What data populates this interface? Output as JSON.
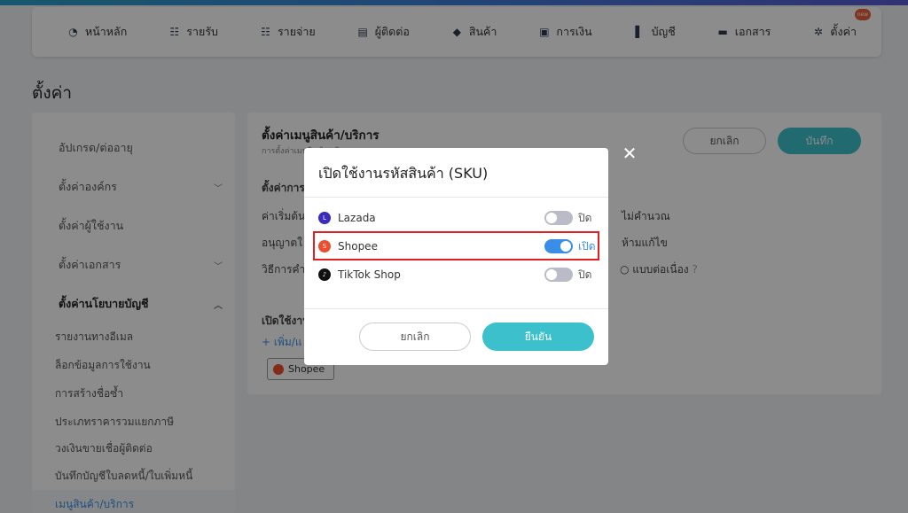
{
  "nav": {
    "items": [
      {
        "label": "หน้าหลัก",
        "icon": "dashboard-icon"
      },
      {
        "label": "รายรับ",
        "icon": "income-icon"
      },
      {
        "label": "รายจ่าย",
        "icon": "expense-icon"
      },
      {
        "label": "ผู้ติดต่อ",
        "icon": "contacts-icon"
      },
      {
        "label": "สินค้า",
        "icon": "box-icon"
      },
      {
        "label": "การเงิน",
        "icon": "money-icon"
      },
      {
        "label": "บัญชี",
        "icon": "book-icon"
      },
      {
        "label": "เอกสาร",
        "icon": "folder-icon"
      },
      {
        "label": "ตั้งค่า",
        "icon": "gear-icon",
        "badge": "new"
      }
    ]
  },
  "page": {
    "title": "ตั้งค่า"
  },
  "sidebar": {
    "items": [
      {
        "label": "อัปเกรด/ต่ออายุ"
      },
      {
        "label": "ตั้งค่าองค์กร"
      },
      {
        "label": "ตั้งค่าผู้ใช้งาน"
      },
      {
        "label": "ตั้งค่าเอกสาร"
      },
      {
        "label": "ตั้งค่านโยบายบัญชี"
      }
    ],
    "subitems": [
      "รายงานทางอีเมล",
      "ล็อกข้อมูลการใช้งาน",
      "การสร้างชื่อซ้ำ",
      "ประเภทราคารวมแยกภาษี",
      "วงเงินขายเชื่อผู้ติดต่อ",
      "บันทึกบัญชีใบลดหนี้/ใบเพิ่มหนี้",
      "เมนูสินค้า/บริการ"
    ]
  },
  "main": {
    "title": "ตั้งค่าเมนูสินค้า/บริการ",
    "desc": "การตั้งค่าเมนูสินค้า/บริการ",
    "cancel": "ยกเลิก",
    "save": "บันทึก",
    "section1": "ตั้งค่าการ",
    "row1": "ค่าเริ่มต้นใ",
    "row1_right": "ไม่คำนวณ",
    "row2": "อนุญาตใ",
    "row2_right": "ห้ามแก้ไข",
    "row3": "วิธีการคำ",
    "row3_right": "แบบต่อเนื่อง",
    "section2": "เปิดใช้งาน",
    "add": "+ เพิ่ม/แ",
    "tag": "Shopee"
  },
  "modal": {
    "title": "เปิดใช้งานรหัสสินค้า (SKU)",
    "platforms": [
      {
        "name": "Lazada",
        "state": "ปิด",
        "on": false,
        "color": "#3b2bbd"
      },
      {
        "name": "Shopee",
        "state": "เปิด",
        "on": true,
        "color": "#ee4d2d"
      },
      {
        "name": "TikTok Shop",
        "state": "ปิด",
        "on": false,
        "color": "#111111"
      }
    ],
    "cancel": "ยกเลิก",
    "confirm": "ยืนยัน"
  }
}
